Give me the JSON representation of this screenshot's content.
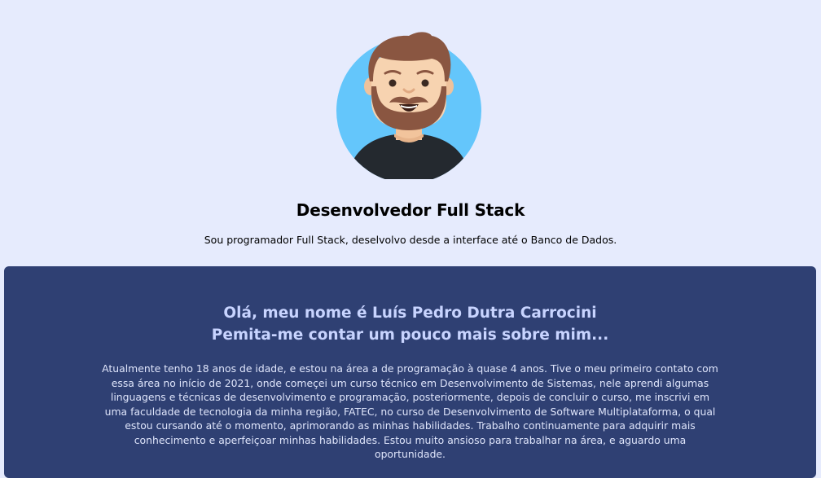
{
  "hero": {
    "avatar_icon": "developer-avatar-icon",
    "title": "Desenvolvedor Full Stack",
    "subtitle": "Sou programador Full Stack, deselvolvo desde a interface até o Banco de Dados."
  },
  "about": {
    "heading_line1": "Olá, meu nome é Luís Pedro Dutra Carrocini",
    "heading_line2": "Pemita-me contar um pouco mais sobre mim...",
    "text": "Atualmente tenho 18 anos de idade, e estou na área a de programação à quase 4 anos. Tive o meu primeiro contato com essa área no início de 2021, onde começei um curso técnico em Desenvolvimento de Sistemas, nele aprendi algumas linguagens e técnicas de desenvolvimento e programação, posteriormente, depois de concluir o curso, me inscrivi em uma faculdade de tecnologia da minha região, FATEC, no curso de Desenvolvimento de Software Multiplataforma, o qual estou cursando até o momento, aprimorando as minhas habilidades. Trabalho continuamente para adquirir mais conhecimento e aperfeiçoar minhas habilidades. Estou muito ansioso para trabalhar na área, e aguardo uma oportunidade."
  },
  "colors": {
    "page_background": "#e6ebfd",
    "about_background": "#2f4073",
    "heading_color": "#c8d4ff",
    "avatar_circle": "#64c6fb",
    "hair": "#8a5641",
    "skin": "#f7d3b0",
    "shirt": "#24292f"
  }
}
